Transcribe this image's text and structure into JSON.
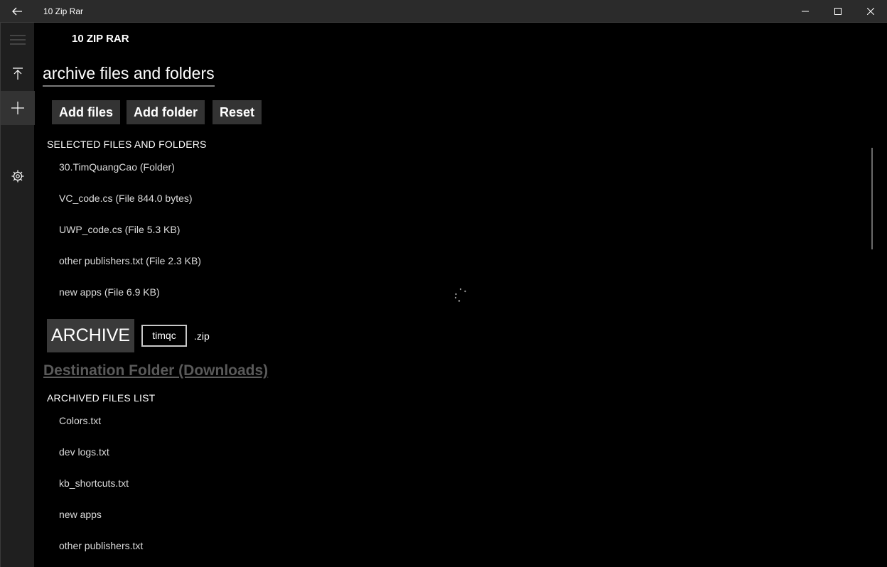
{
  "window": {
    "title": "10 Zip Rar"
  },
  "app": {
    "title": "10 ZIP RAR"
  },
  "page": {
    "heading": "archive files and folders"
  },
  "actions": {
    "add_files": "Add files",
    "add_folder": "Add folder",
    "reset": "Reset"
  },
  "selected": {
    "header": "SELECTED FILES AND FOLDERS",
    "items": [
      "30.TimQuangCao (Folder)",
      "VC_code.cs (File 844.0 bytes)",
      "UWP_code.cs (File 5.3 KB)",
      "other publishers.txt (File 2.3 KB)",
      "new apps (File 6.9 KB)"
    ]
  },
  "archive": {
    "button": "ARCHIVE",
    "name_value": "timqc",
    "extension": ".zip"
  },
  "destination": {
    "label": "Destination Folder (Downloads)"
  },
  "archived": {
    "header": "ARCHIVED FILES LIST",
    "items": [
      "Colors.txt",
      "dev logs.txt",
      "kb_shortcuts.txt",
      "new apps",
      "other publishers.txt"
    ]
  },
  "icons": {
    "back": "back-arrow-icon",
    "minimize": "minimize-icon",
    "maximize": "maximize-icon",
    "close": "close-icon",
    "menu": "hamburger-icon",
    "extract": "extract-icon",
    "add": "plus-icon",
    "settings": "gear-icon"
  },
  "colors": {
    "background": "#000000",
    "sidebar": "#1f1f1f",
    "titlebar": "#2b2b2b",
    "button": "#333333",
    "link": "#5a5a5a"
  }
}
